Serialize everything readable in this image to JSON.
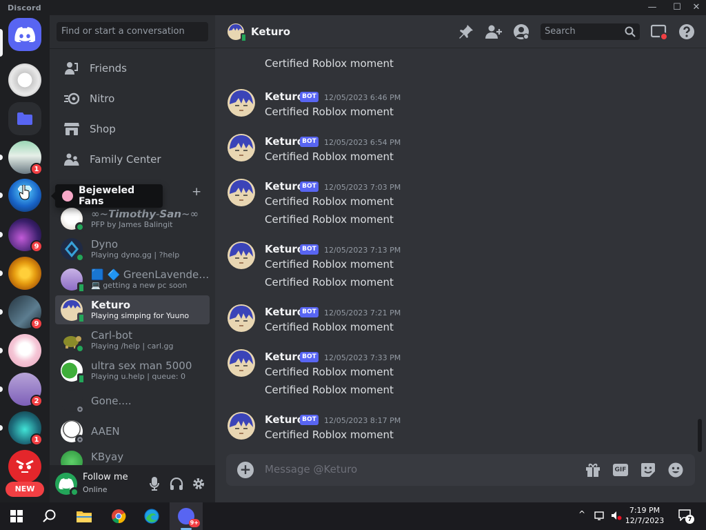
{
  "titlebar": {
    "app_name": "Discord",
    "minimize": "—",
    "maximize": "☐",
    "close": "✕"
  },
  "servers": {
    "badges": [
      "1",
      "9",
      "9",
      "2",
      "1"
    ],
    "new_label": "NEW"
  },
  "tooltip": {
    "text": "Bejeweled Fans"
  },
  "dm_panel": {
    "search_placeholder": "Find or start a conversation",
    "nav": [
      {
        "label": "Friends",
        "icon": "friends-icon"
      },
      {
        "label": "Nitro",
        "icon": "nitro-icon"
      },
      {
        "label": "Shop",
        "icon": "shop-icon"
      },
      {
        "label": "Family Center",
        "icon": "family-icon"
      }
    ],
    "add_dm": "+",
    "dms": [
      {
        "name": "∞~𝙏𝙞𝙢𝙤𝙩𝙝𝙮-𝙎𝙖𝙣~∞",
        "sub": "PFP by James Balingit",
        "status": "online"
      },
      {
        "name": "Dyno",
        "sub": "Playing dyno.gg | ?help",
        "status": "online"
      },
      {
        "name": "🟦 🔷 GreenLavender...",
        "sub": "💻 getting a new pc soon",
        "status": "mobile"
      },
      {
        "name": "Keturo",
        "sub": "Playing simping for Yuuno",
        "status": "mobile"
      },
      {
        "name": "Carl-bot",
        "sub": "Playing /help | carl.gg",
        "status": "online"
      },
      {
        "name": "ultra sex man 5000",
        "sub": "Playing u.help | queue: 0",
        "status": "mobile"
      },
      {
        "name": "Gone....",
        "sub": "",
        "status": "offline"
      },
      {
        "name": "AAEN",
        "sub": "",
        "status": "offline"
      },
      {
        "name": "KByay",
        "sub": "",
        "status": "online"
      }
    ]
  },
  "userbar": {
    "name": "Follow me",
    "status": "Online"
  },
  "chat": {
    "title": "Keturo",
    "search_placeholder": "Search",
    "bot_label": "BOT",
    "top_partial": "Certified Roblox moment",
    "messages": [
      {
        "author": "Keturo",
        "time": "12/05/2023 6:46 PM",
        "lines": [
          "Certified Roblox moment"
        ]
      },
      {
        "author": "Keturo",
        "time": "12/05/2023 6:54 PM",
        "lines": [
          "Certified Roblox moment"
        ]
      },
      {
        "author": "Keturo",
        "time": "12/05/2023 7:03 PM",
        "lines": [
          "Certified Roblox moment",
          "Certified Roblox moment"
        ]
      },
      {
        "author": "Keturo",
        "time": "12/05/2023 7:13 PM",
        "lines": [
          "Certified Roblox moment",
          "Certified Roblox moment"
        ]
      },
      {
        "author": "Keturo",
        "time": "12/05/2023 7:21 PM",
        "lines": [
          "Certified Roblox moment"
        ]
      },
      {
        "author": "Keturo",
        "time": "12/05/2023 7:33 PM",
        "lines": [
          "Certified Roblox moment",
          "Certified Roblox moment"
        ]
      },
      {
        "author": "Keturo",
        "time": "12/05/2023 8:17 PM",
        "lines": [
          "Certified Roblox moment"
        ]
      }
    ],
    "composer_placeholder": "Message @Keturo",
    "gif_label": "GIF"
  },
  "taskbar": {
    "time": "7:19 PM",
    "date": "12/7/2023",
    "discord_badge": "9+",
    "notifications": "7"
  },
  "colors": {
    "blurple": "#5865f2",
    "online": "#23a559",
    "mention": "#f23f43"
  }
}
